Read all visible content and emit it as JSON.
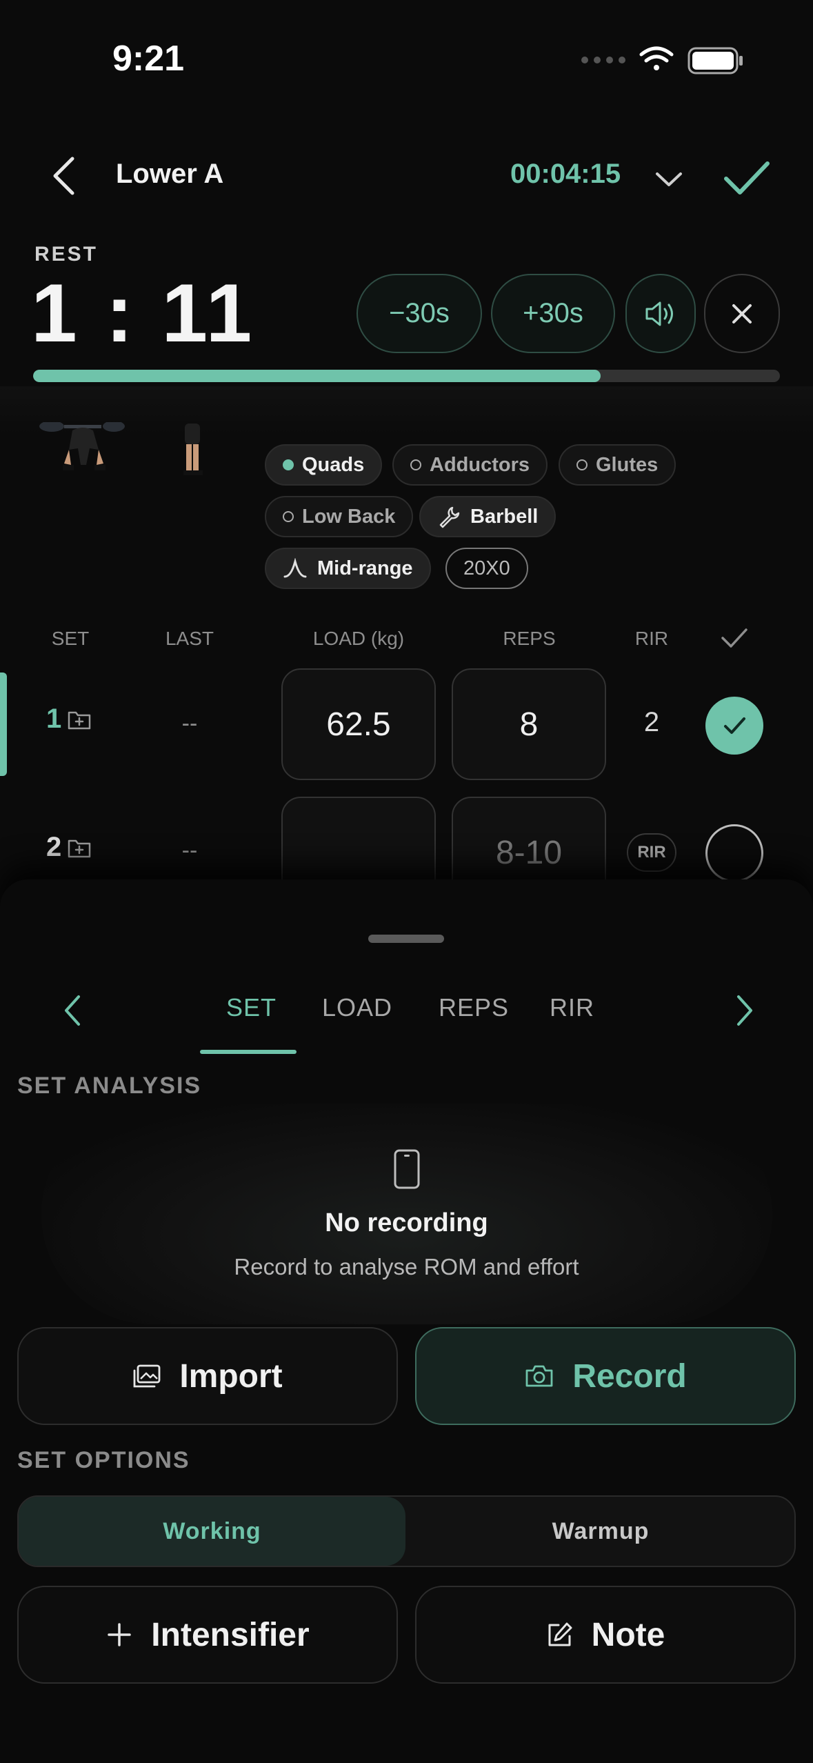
{
  "status_bar": {
    "time": "9:21"
  },
  "header": {
    "title": "Lower A",
    "elapsed": "00:04:15"
  },
  "rest": {
    "label": "REST",
    "time": "1 : 11",
    "minus_label": "−30s",
    "plus_label": "+30s",
    "progress_fraction": 0.76
  },
  "tags": {
    "quads": "Quads",
    "adductors": "Adductors",
    "glutes": "Glutes",
    "lowback": "Low Back",
    "barbell": "Barbell",
    "midrange": "Mid-range",
    "tempo": "20X0"
  },
  "table": {
    "headers": {
      "set": "SET",
      "last": "LAST",
      "load": "LOAD (kg)",
      "reps": "REPS",
      "rir": "RIR"
    },
    "rows": [
      {
        "set": "1",
        "last": "--",
        "load": "62.5",
        "reps": "8",
        "rir": "2",
        "done": true
      },
      {
        "set": "2",
        "last": "--",
        "load": "",
        "reps_placeholder": "8-10",
        "rir": "RIR",
        "done": false
      }
    ]
  },
  "sheet": {
    "tabs": [
      "SET",
      "LOAD",
      "REPS",
      "RIR"
    ],
    "analysis_title": "SET ANALYSIS",
    "no_recording": "No recording",
    "no_recording_sub": "Record to analyse ROM and effort",
    "import_label": "Import",
    "record_label": "Record",
    "options_title": "SET OPTIONS",
    "working_label": "Working",
    "warmup_label": "Warmup",
    "intensifier_label": "Intensifier",
    "note_label": "Note"
  },
  "colors": {
    "accent": "#6fc3aa",
    "background": "#0b0b0b"
  }
}
